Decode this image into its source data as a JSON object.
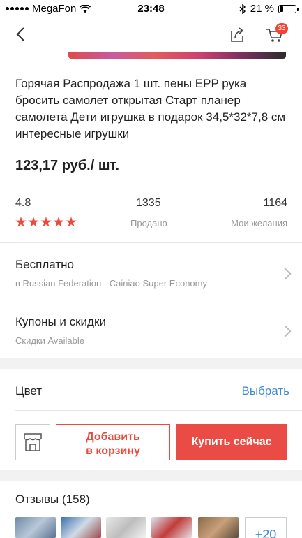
{
  "status_bar": {
    "carrier": "MegaFon",
    "time": "23:48",
    "battery_percent": "21 %",
    "battery_level": 0.21
  },
  "nav": {
    "cart_count": "33",
    "icons": [
      "chevron-left-icon",
      "share-icon",
      "cart-icon"
    ]
  },
  "product": {
    "title": "Горячая Распродажа 1 шт. пены EPP рука бросить самолет открытая Старт планер самолета Дети игрушка в подарок 34,5*32*7,8 см интересные игрушки",
    "price": "123,17 руб./ шт."
  },
  "stats": {
    "rating": "4.8",
    "rating_stars": 5,
    "sold_count": "1335",
    "sold_label": "Продано",
    "wishlist_count": "1164",
    "wishlist_label": "Мои желания"
  },
  "shipping": {
    "title": "Бесплатно",
    "subtitle": "в Russian Federation - Cainiao Super Economy"
  },
  "coupons": {
    "title": "Купоны и скидки",
    "subtitle": "Скидки Available"
  },
  "color": {
    "label": "Цвет",
    "action": "Выбрать"
  },
  "actions": {
    "add_to_cart_line1": "Добавить",
    "add_to_cart_line2": "в корзину",
    "buy_now": "Купить сейчас"
  },
  "reviews": {
    "title": "Отзывы (158)",
    "more_label": "+20"
  },
  "colors": {
    "accent_red": "#ea4c45",
    "link_blue": "#3d8bd6",
    "star": "#e94b3c"
  }
}
